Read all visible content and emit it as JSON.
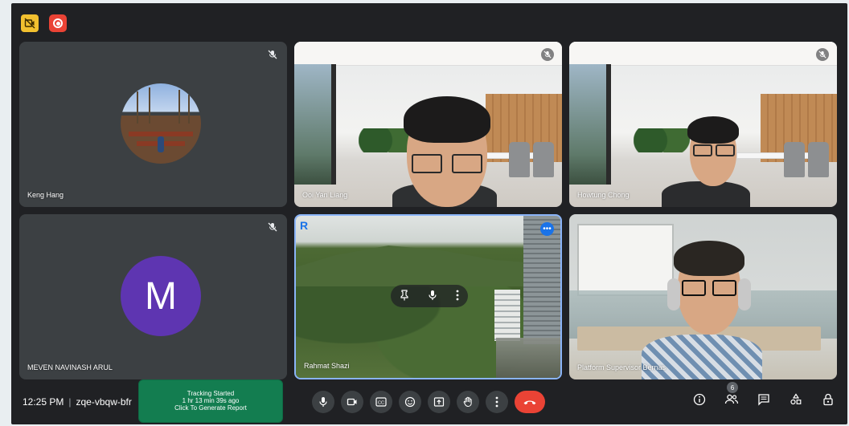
{
  "top_icons": {
    "camera_off": "camera-off-icon",
    "recording": "recording-icon"
  },
  "participants": [
    {
      "name": "Keng Hang",
      "type": "avatar-photo",
      "muted": true
    },
    {
      "name": "Ooi Yan Liang",
      "type": "video",
      "muted": true
    },
    {
      "name": "Howtung Chong",
      "type": "video",
      "muted": true
    },
    {
      "name": "MEVEN NAVINASH ARUL",
      "type": "avatar-letter",
      "avatar_letter": "M",
      "avatar_color": "#5e35b1",
      "muted": true
    },
    {
      "name": "Rahmat Shazi",
      "type": "video",
      "muted": false,
      "highlighted": true
    },
    {
      "name": "Platform Supervisor Bernas",
      "type": "video",
      "muted": false
    }
  ],
  "hover_controls": [
    "pin-icon",
    "mic-icon",
    "more-vert-icon"
  ],
  "meeting": {
    "time": "12:25 PM",
    "separator": "|",
    "code": "zqe-vbqw-bfr"
  },
  "tracking": {
    "line1": "Tracking Started",
    "line2": "1 hr 13 min 39s ago",
    "line3": "Click To Generate Report",
    "color": "#137d50"
  },
  "controls": [
    "mic-icon",
    "camera-icon",
    "captions-icon",
    "emoji-icon",
    "present-icon",
    "raise-hand-icon",
    "more-vert-icon",
    "end-call-icon"
  ],
  "right_controls": {
    "people_count": "6",
    "icons": [
      "info-icon",
      "people-icon",
      "chat-icon",
      "activities-icon",
      "host-controls-icon"
    ]
  },
  "colors": {
    "background": "#202124",
    "tile": "#3c4043",
    "end_call": "#ea4335",
    "accent": "#1a73e8"
  }
}
